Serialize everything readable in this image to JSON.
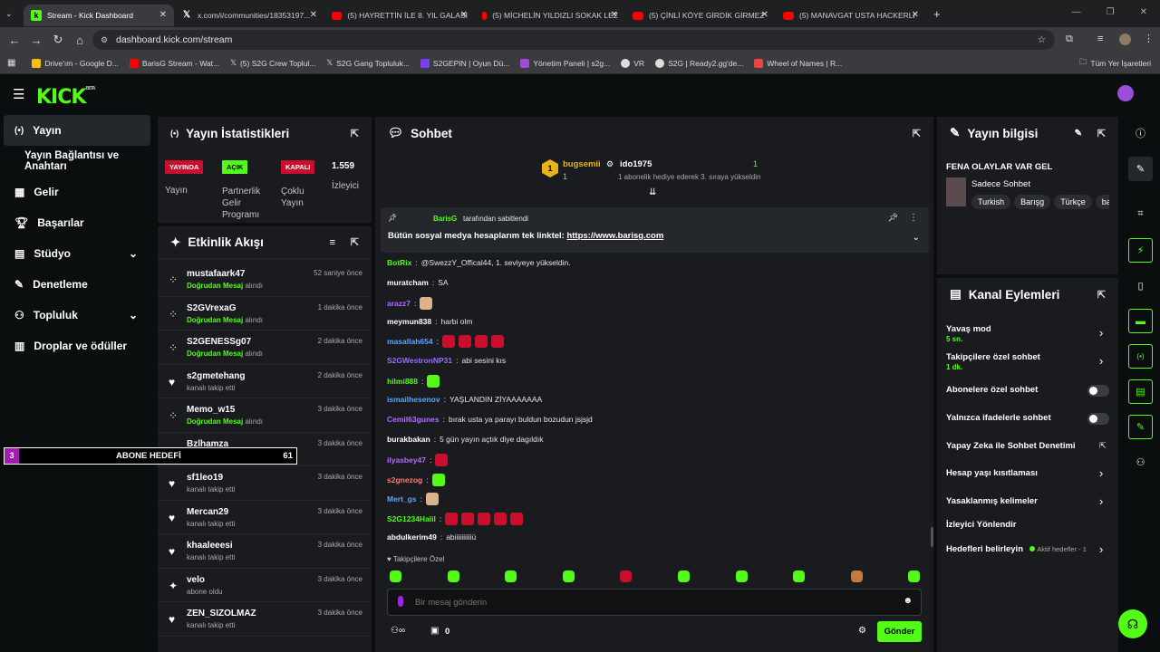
{
  "browser": {
    "tabs": [
      {
        "label": "Stream - Kick Dashboard",
        "icon": "kick"
      },
      {
        "label": "x.com/i/communities/18353197...",
        "icon": "x"
      },
      {
        "label": "(5) HAYRETTİN İLE 8. YIL GALASI",
        "icon": "youtube"
      },
      {
        "label": "(5) MİCHELİN YILDIZLI SOKAK LEZ",
        "icon": "youtube"
      },
      {
        "label": "(5) ÇİNLİ KÖYE GİRDİK GİRMEZ",
        "icon": "youtube"
      },
      {
        "label": "(5) MANAVGAT USTA HACKERLI",
        "icon": "youtube"
      }
    ],
    "url": "dashboard.kick.com/stream",
    "bookmarks": [
      "Drive'ım - Google D...",
      "BarisG Stream - Wat...",
      "(5) S2G Crew Toplul...",
      "S2G Gang Topluluk...",
      "S2GEPIN | Oyun Dü...",
      "Yönetim Paneli | s2g...",
      "VR",
      "S2G | Ready2.gg'de...",
      "Wheel of Names | R..."
    ],
    "bookmarks_right": "Tüm Yer İşaretleri"
  },
  "app": {
    "logo": "KICK",
    "beta": "BETA"
  },
  "sidebar": {
    "items": [
      {
        "label": "Yayın",
        "icon": "broadcast-icon"
      },
      {
        "label": "Yayın Bağlantısı ve Anahtarı",
        "icon": ""
      },
      {
        "label": "Gelir",
        "icon": "grid-icon"
      },
      {
        "label": "Başarılar",
        "icon": "trophy-icon"
      },
      {
        "label": "Stüdyo",
        "icon": "studio-icon"
      },
      {
        "label": "Denetleme",
        "icon": "wrench-icon"
      },
      {
        "label": "Topluluk",
        "icon": "people-icon"
      },
      {
        "label": "Droplar ve ödüller",
        "icon": "chart-icon"
      }
    ]
  },
  "stats": {
    "title": "Yayın İstatistikleri",
    "live_badge": "YAYINDA",
    "live_label": "Yayın",
    "partner_badge": "AÇIK",
    "partner_label": "Partnerlik Gelir Programı",
    "multi_badge": "KAPALI",
    "multi_label": "Çoklu Yayın",
    "viewers": "1.559",
    "viewers_label": "İzleyici"
  },
  "activity": {
    "title": "Etkinlik Akışı",
    "rows": [
      {
        "name": "mustafaark47",
        "prefix": "Doğrudan Mesaj",
        "suffix": " alındı",
        "time": "52 saniye önce",
        "icon": "dm"
      },
      {
        "name": "S2GVrexaG",
        "prefix": "Doğrudan Mesaj",
        "suffix": " alındı",
        "time": "1 dakika önce",
        "icon": "dm"
      },
      {
        "name": "S2GENESSg07",
        "prefix": "Doğrudan Mesaj",
        "suffix": " alındı",
        "time": "2 dakika önce",
        "icon": "dm"
      },
      {
        "name": "s2gmetehang",
        "prefix": "",
        "suffix": "kanalı takip etti",
        "time": "2 dakika önce",
        "icon": "heart"
      },
      {
        "name": "Memo_w15",
        "prefix": "Doğrudan Mesaj",
        "suffix": " alındı",
        "time": "3 dakika önce",
        "icon": "dm"
      },
      {
        "name": "Bzlhamza",
        "prefix": "",
        "suffix": "kanalı takip etti",
        "time": "3 dakika önce",
        "icon": "heart"
      },
      {
        "name": "sf1leo19",
        "prefix": "",
        "suffix": "kanalı takip etti",
        "time": "3 dakika önce",
        "icon": "heart"
      },
      {
        "name": "Mercan29",
        "prefix": "",
        "suffix": "kanalı takip etti",
        "time": "3 dakika önce",
        "icon": "heart"
      },
      {
        "name": "khaaleeesi",
        "prefix": "",
        "suffix": "kanalı takip etti",
        "time": "3 dakika önce",
        "icon": "heart"
      },
      {
        "name": "velo",
        "prefix": "",
        "suffix": "abone oldu",
        "time": "3 dakika önce",
        "icon": "sparkle"
      },
      {
        "name": "ZEN_SIZOLMAZ",
        "prefix": "",
        "suffix": "kanalı takip etti",
        "time": "3 dakika önce",
        "icon": "heart"
      }
    ]
  },
  "sub_goal": {
    "num": "3",
    "label": "ABONE HEDEFİ",
    "value": "61"
  },
  "chat": {
    "title": "Sohbet",
    "gift_top": {
      "user1": "bugsemii",
      "user2": "ido1975",
      "count_left": "1",
      "count_right": "1",
      "text": "1 abonelik hediye ederek 3. sıraya yükseldin"
    },
    "pinned": {
      "by": "BarisG",
      "by_suffix": "tarafından sabitlendi",
      "text": "Bütün sosyal medya hesaplarım tek linktel: ",
      "link": "https://www.barisg.com"
    },
    "messages": [
      {
        "user": "BotRix",
        "color": "#53fc18",
        "text": "@SwezzY_Offical44, 1. seviyeye yükseldin.",
        "emotes": 0
      },
      {
        "user": "muratcham",
        "color": "#ffffff",
        "text": "SA",
        "emotes": 0
      },
      {
        "user": "arazz7",
        "color": "#b46cff",
        "text": "",
        "emotes": 1
      },
      {
        "user": "meymun838",
        "color": "#ffffff",
        "text": "harbi olm",
        "emotes": 0
      },
      {
        "user": "masallah654",
        "color": "#58a6ff",
        "text": "",
        "emotes": 4
      },
      {
        "user": "S2GWestronNP31",
        "color": "#9d6cff",
        "text": "abi sesini kıs",
        "emotes": 0
      },
      {
        "user": "hilmi888",
        "color": "#53fc18",
        "text": "",
        "emotes": 1
      },
      {
        "user": "ismailhesenov",
        "color": "#58a6ff",
        "text": "YAŞLANDIN ZİYAAAAAAA",
        "emotes": 0
      },
      {
        "user": "Cemil63gunes",
        "color": "#b46cff",
        "text": "bırak usta ya parayı buldun bozudun jsjsjd",
        "emotes": 0
      },
      {
        "user": "burakbakan",
        "color": "#ffffff",
        "text": "5 gün yayın açtık diye dagıldık",
        "emotes": 0
      },
      {
        "user": "ilyasbey47",
        "color": "#b46cff",
        "text": "",
        "emotes": 1
      },
      {
        "user": "s2gnezog",
        "color": "#ff7a7a",
        "text": "",
        "emotes": 1
      },
      {
        "user": "Mert_gs",
        "color": "#58a6ff",
        "text": "",
        "emotes": 1
      },
      {
        "user": "S2G1234Halil",
        "color": "#53fc18",
        "text": "",
        "emotes": 5
      },
      {
        "user": "abdulkerim49",
        "color": "#ffffff",
        "text": "abiiiiiiiiiiü",
        "emotes": 0
      }
    ],
    "followers_only": "Takipçilere Özel",
    "input_placeholder": "Bir mesaj gönderin",
    "viewers_count": "0",
    "send_label": "Gönder"
  },
  "stream_info": {
    "title": "Yayın bilgisi",
    "stream_title": "FENA OLAYLAR VAR GEL",
    "category": "Sadece Sohbet",
    "tags": [
      "Turkish",
      "Barışg",
      "Türkçe",
      "ba"
    ]
  },
  "channel_actions": {
    "title": "Kanal Eylemleri",
    "items": [
      {
        "label": "Yavaş mod",
        "sub": "5 sn.",
        "control": "chevron"
      },
      {
        "label": "Takipçilere özel sohbet",
        "sub": "1 dk.",
        "control": "chevron"
      },
      {
        "label": "Abonelere özel sohbet",
        "sub": "",
        "control": "toggle"
      },
      {
        "label": "Yalnızca ifadelerle sohbet",
        "sub": "",
        "control": "toggle"
      },
      {
        "label": "Yapay Zeka ile Sohbet Denetimi",
        "sub": "",
        "control": "external"
      },
      {
        "label": "Hesap yaşı kısıtlaması",
        "sub": "",
        "control": "chevron"
      },
      {
        "label": "Yasaklanmış kelimeler",
        "sub": "",
        "control": "chevron"
      },
      {
        "label": "İzleyici Yönlendir",
        "sub": "",
        "control": "none"
      },
      {
        "label": "Hedefleri belirleyin",
        "sub": "Aktif hedefler - 1",
        "control": "chevron"
      }
    ]
  },
  "colors": {
    "accent": "#53fc18",
    "live": "#c8102e",
    "panel": "#191b1f",
    "bg": "#0b0e0f"
  }
}
